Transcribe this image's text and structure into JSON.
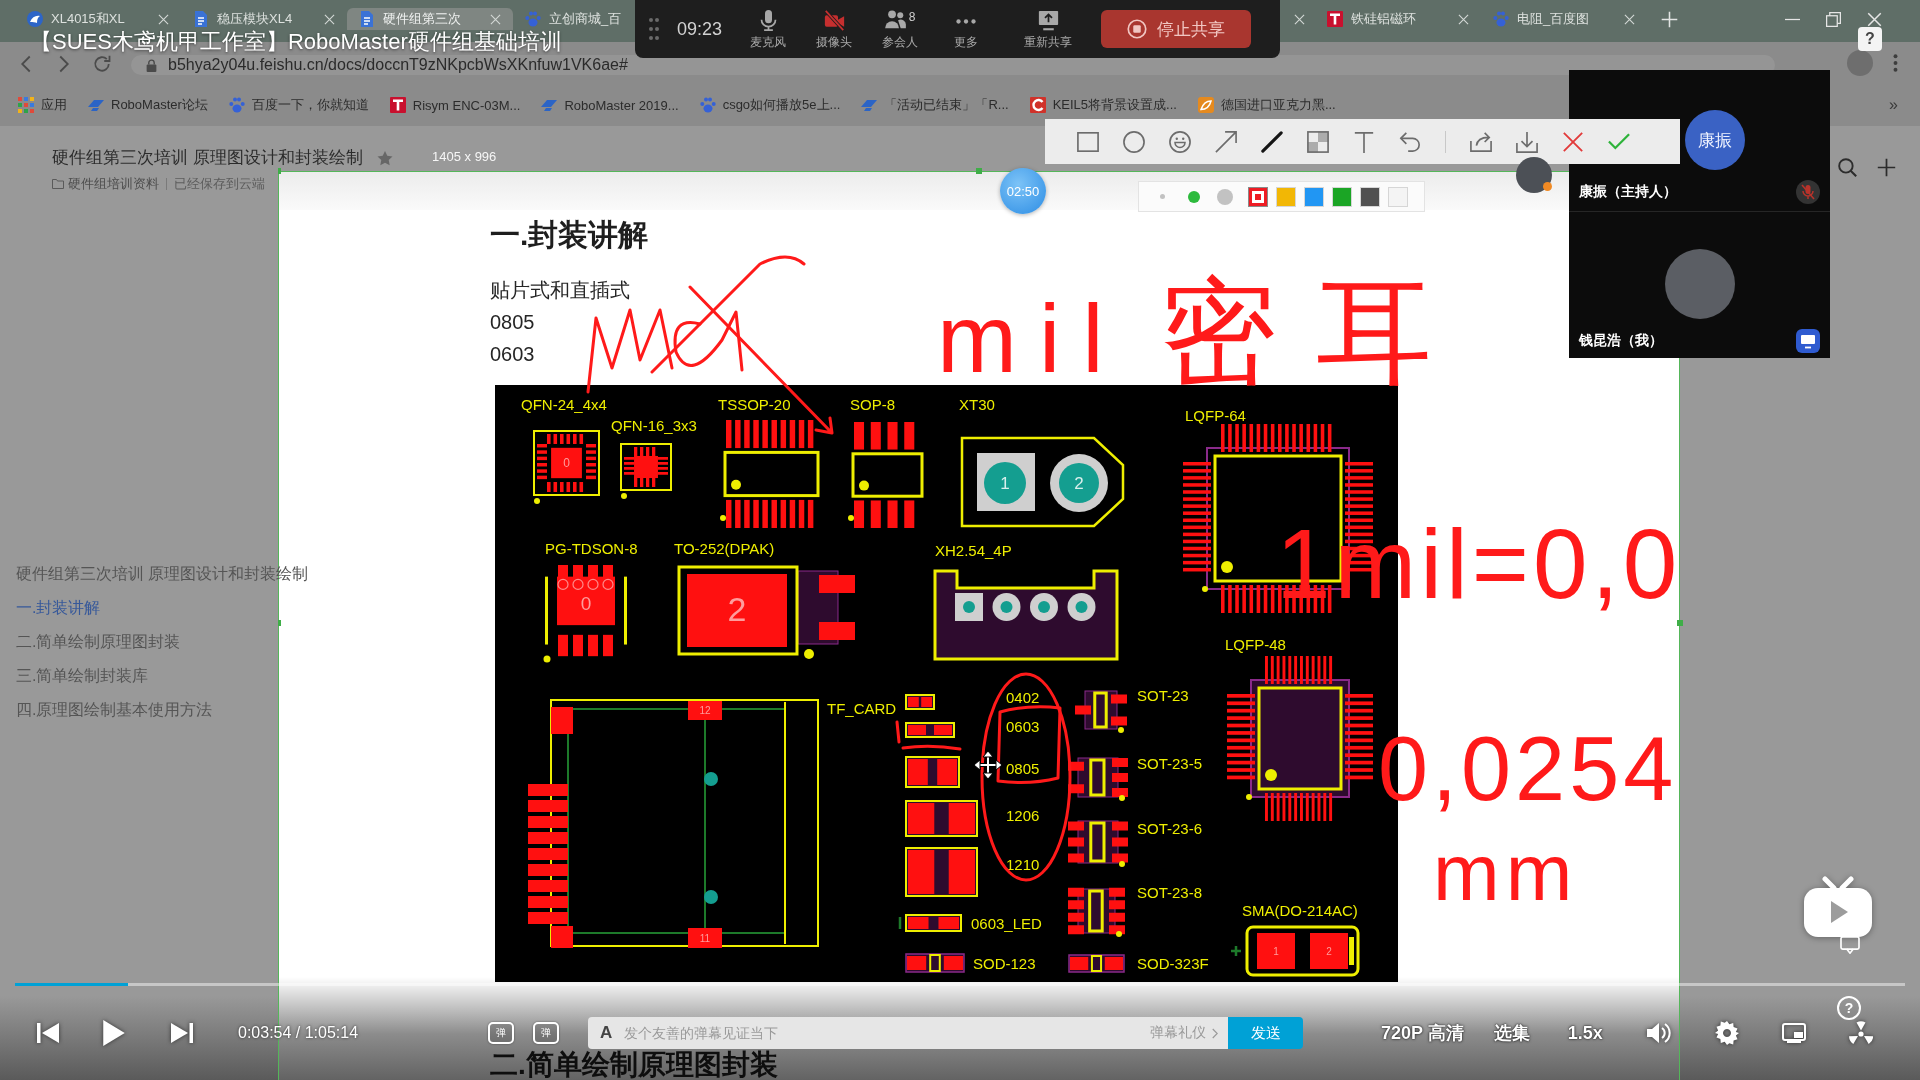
{
  "video_title": "【SUES木鸢机甲工作室】RoboMaster硬件组基础培训",
  "browser": {
    "tabs": [
      {
        "label": "XL4015和XL",
        "kind": "swirl",
        "selected": false
      },
      {
        "label": "稳压模块XL4",
        "kind": "doc",
        "selected": false
      },
      {
        "label": "硬件组第三次",
        "kind": "doc",
        "selected": true
      },
      {
        "label": "立创商城_百",
        "kind": "paw",
        "selected": false
      }
    ],
    "tabs_right": [
      {
        "selected": false
      },
      {
        "label": "铁硅铝磁环",
        "kind": "t",
        "selected": false
      },
      {
        "label": "电阻_百度图",
        "kind": "paw",
        "selected": false
      }
    ],
    "url": "b5hya2y04u.feishu.cn/docs/doccnT9zNKpcbWsXKnfuw1VK6ae#",
    "bookmarks": [
      {
        "label": "应用",
        "kind": "apps"
      },
      {
        "label": "RoboMaster论坛",
        "kind": "wing"
      },
      {
        "label": "百度一下，你就知道",
        "kind": "paw"
      },
      {
        "label": "Risym ENC-03M...",
        "kind": "t"
      },
      {
        "label": "RoboMaster 2019...",
        "kind": "wing"
      },
      {
        "label": "csgo如何播放5e上...",
        "kind": "paw"
      },
      {
        "label": "「活动已结束」「R...",
        "kind": "wing"
      },
      {
        "label": "KEIL5将背景设置成...",
        "kind": "c"
      },
      {
        "label": "德国进口亚克力黑...",
        "kind": "leaf"
      }
    ],
    "bookmarks_more": "»"
  },
  "meeting_bar": {
    "time": "09:23",
    "controls": [
      {
        "kind": "mic",
        "label": "麦克风"
      },
      {
        "kind": "camera_off",
        "label": "摄像头"
      },
      {
        "kind": "people",
        "label": "参会人",
        "count": "8"
      },
      {
        "kind": "more",
        "label": "更多"
      },
      {
        "kind": "reshare",
        "label": "重新共享"
      }
    ],
    "stop_button": "停止共享"
  },
  "document": {
    "title": "硬件组第三次培训 原理图设计和封装绘制",
    "folder": "硬件组培训资料",
    "save_status": "已经保存到云端",
    "outline": [
      {
        "label": "硬件组第三次培训 原理图设计和封装绘制",
        "selected": false
      },
      {
        "label": "一.封装讲解",
        "selected": true
      },
      {
        "label": "二.简单绘制原理图封装",
        "selected": false
      },
      {
        "label": "三.简单绘制封装库",
        "selected": false
      },
      {
        "label": "四.原理图绘制基本使用方法",
        "selected": false
      }
    ],
    "heading": "一.封装讲解",
    "paragraphs": [
      "贴片式和直插式",
      "0805",
      "0603"
    ],
    "pcb_image": {
      "footprints": [
        {
          "label": "QFN-24_4x4",
          "kind": "qfn",
          "pads": [
            "0"
          ]
        },
        {
          "label": "QFN-16_3x3",
          "kind": "qfn"
        },
        {
          "label": "TSSOP-20",
          "kind": "soic"
        },
        {
          "label": "SOP-8",
          "kind": "soic"
        },
        {
          "label": "XT30",
          "kind": "xt30",
          "pads": [
            "1",
            "2"
          ]
        },
        {
          "label": "LQFP-64",
          "kind": "lqfp"
        },
        {
          "label": "PG-TDSON-8",
          "kind": "tdson",
          "pads": [
            "0"
          ]
        },
        {
          "label": "TO-252(DPAK)",
          "kind": "dpak",
          "pads": [
            "2"
          ]
        },
        {
          "label": "XH2.54_4P",
          "kind": "header"
        },
        {
          "label": "LQFP-48",
          "kind": "lqfp"
        },
        {
          "label": "TF_CARD",
          "kind": "tfcard",
          "pads": [
            "12",
            "11"
          ]
        },
        {
          "label": "0402",
          "kind": "chip"
        },
        {
          "label": "0603",
          "kind": "chip"
        },
        {
          "label": "0805",
          "kind": "chip"
        },
        {
          "label": "1206",
          "kind": "chip"
        },
        {
          "label": "1210",
          "kind": "chip"
        },
        {
          "label": "SOT-23",
          "kind": "sot"
        },
        {
          "label": "SOT-23-5",
          "kind": "sot"
        },
        {
          "label": "SOT-23-6",
          "kind": "sot"
        },
        {
          "label": "SOT-23-8",
          "kind": "sot"
        },
        {
          "label": "0603_LED",
          "kind": "led"
        },
        {
          "label": "SOD-123",
          "kind": "diode"
        },
        {
          "label": "SOD-323F",
          "kind": "diode"
        },
        {
          "label": "SMA(DO-214AC)",
          "kind": "sma",
          "pads": [
            "1",
            "2"
          ]
        }
      ]
    },
    "next_heading": "二.简单绘制原理图封装"
  },
  "screen_annotation": {
    "size_label": "1405 x 996",
    "timer": "02:50",
    "tools": [
      {
        "kind": "rectangle",
        "selected": false
      },
      {
        "kind": "ellipse",
        "selected": false
      },
      {
        "kind": "emoji",
        "selected": false
      },
      {
        "kind": "arrow",
        "selected": false
      },
      {
        "kind": "pen",
        "selected": true
      },
      {
        "kind": "mosaic",
        "selected": false
      },
      {
        "kind": "text",
        "selected": false
      },
      {
        "kind": "undo",
        "selected": false
      }
    ],
    "actions": [
      {
        "kind": "export"
      },
      {
        "kind": "download"
      },
      {
        "kind": "cancel"
      },
      {
        "kind": "confirm"
      }
    ],
    "pen_sizes": [
      {
        "selected": false
      },
      {
        "selected": true
      },
      {
        "selected": false
      }
    ],
    "colors": [
      {
        "color": "#ee1c24",
        "selected": true
      },
      {
        "color": "#f2b705",
        "selected": false
      },
      {
        "color": "#2196f3",
        "selected": false
      },
      {
        "color": "#1ba525",
        "selected": false
      },
      {
        "color": "#505050",
        "selected": false
      },
      {
        "color": "#f4f4f4",
        "selected": false
      }
    ],
    "ink_notes": [
      "mil",
      "密耳",
      "1mil=0,0",
      "0,0254",
      "mm"
    ]
  },
  "participants": [
    {
      "name": "康振（主持人）",
      "kind": "initials",
      "avatar_text": "康振",
      "muted": true,
      "sharing": false
    },
    {
      "name": "钱昆浩（我）",
      "kind": "photo",
      "muted": false,
      "sharing": true
    }
  ],
  "help_bubble": "?",
  "player": {
    "time": "0:03:54 / 1:05:14",
    "level": 0.06,
    "danmaku_toggles": [
      "弹",
      "弹"
    ],
    "danmaku_style": "A",
    "danmaku_placeholder": "发个友善的弹幕见证当下",
    "etiquette": "弹幕礼仪",
    "send": "发送",
    "quality": "720P 高清",
    "episodes": "选集",
    "speed": "1.5x",
    "help": "?"
  }
}
